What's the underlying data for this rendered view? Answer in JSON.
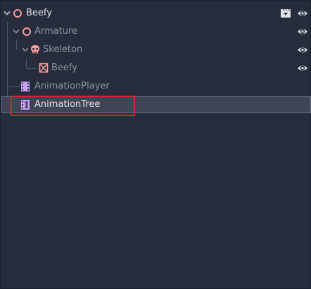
{
  "tree": {
    "nodes": [
      {
        "label": "Beefy",
        "icon": "node3d-icon",
        "state": "expanded",
        "visible": true,
        "extra_icon": "scene-instance-icon"
      },
      {
        "label": "Armature",
        "icon": "node3d-icon",
        "state": "expanded",
        "visible": true
      },
      {
        "label": "Skeleton",
        "icon": "skeleton-icon",
        "state": "expanded",
        "visible": true
      },
      {
        "label": "Beefy",
        "icon": "mesh-instance-icon",
        "visible": true
      },
      {
        "label": "AnimationPlayer",
        "icon": "animation-player-icon"
      },
      {
        "label": "AnimationTree",
        "icon": "animation-tree-icon",
        "selected": true
      }
    ]
  },
  "colors": {
    "background": "#262c3b",
    "node3d": "#fc9c9c",
    "animation": "#c6a2f6",
    "selected_row": "#3f4554",
    "highlight": "#e0202a"
  }
}
